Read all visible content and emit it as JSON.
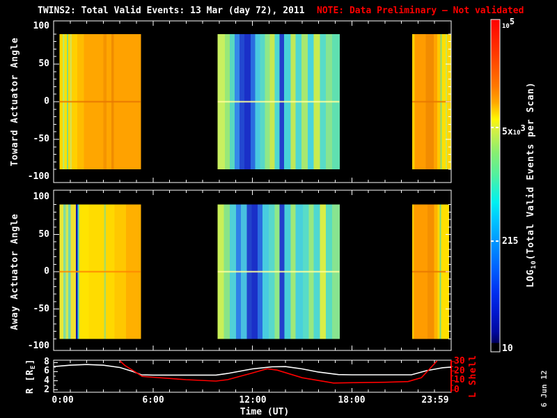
{
  "title": {
    "text": "TWINS2: Total Valid Events: 13 Mar (day  72), 2011",
    "note": "NOTE: Data Preliminary — Not validated"
  },
  "datestamp": "6 Jun 12",
  "colors": {
    "background": "#000000",
    "foreground": "#ffffff",
    "note_red": "#ff0000",
    "r_line": "#ffffff",
    "l_shell_line": "#ff0000"
  },
  "panels": {
    "toward": {
      "ylabel": "Toward Actuator Angle",
      "yticks": [
        "100",
        "50",
        "0",
        "-50",
        "-100"
      ]
    },
    "away": {
      "ylabel": "Away Actuator Angle",
      "yticks": [
        "100",
        "50",
        "0",
        "-50",
        "-100"
      ]
    },
    "bottom": {
      "rlabel_pre": "R [R",
      "rlabel_sub": "E",
      "rlabel_post": "]",
      "yticks_left": [
        "8",
        "6",
        "4",
        "2"
      ],
      "ylabel_right": "L Shell",
      "yticks_right": [
        "30",
        "20",
        "10",
        "0"
      ],
      "xlabel": "Time (UT)",
      "xticks": [
        {
          "label": "0:00",
          "h": 0
        },
        {
          "label": "6:00",
          "h": 6
        },
        {
          "label": "12:00",
          "h": 12
        },
        {
          "label": "18:00",
          "h": 18
        },
        {
          "label": "23:59",
          "h": 23.93
        }
      ]
    }
  },
  "colorbar": {
    "title_pre": "LOG",
    "title_sub": "10",
    "title_post": "(Total Valid Events per Scan)",
    "tick_top_base": "10",
    "tick_top_exp": "5",
    "tick_mid1_pre": "5x",
    "tick_mid1_base": "10",
    "tick_mid1_exp": "3",
    "tick_mid2": "215",
    "tick_bottom": "10"
  },
  "chart_data": [
    {
      "type": "heatmap",
      "name": "toward_actuator",
      "title": "Toward Actuator Angle vs Time",
      "xlim_hours": [
        0,
        24
      ],
      "ylim": [
        -100,
        100
      ],
      "data_angle_extent": [
        -90,
        90
      ],
      "blocks": [
        {
          "t0": 0.35,
          "t1": 5.25,
          "zero_line_color": "#e87800",
          "stripes": [
            [
              0,
              0.04,
              "#ffd800"
            ],
            [
              0.04,
              0.06,
              "#bfe860"
            ],
            [
              0.06,
              0.09,
              "#ffe000"
            ],
            [
              0.09,
              0.11,
              "#80dc80"
            ],
            [
              0.11,
              0.13,
              "#ffd800"
            ],
            [
              0.13,
              0.15,
              "#d8e050"
            ],
            [
              0.15,
              0.22,
              "#ffd000"
            ],
            [
              0.22,
              0.3,
              "#ffbc00"
            ],
            [
              0.3,
              0.54,
              "#ffa600"
            ],
            [
              0.54,
              0.58,
              "#f59400"
            ],
            [
              0.58,
              0.64,
              "#ffa600"
            ],
            [
              0.64,
              0.67,
              "#f08c00"
            ],
            [
              0.67,
              1,
              "#ffa200"
            ]
          ]
        },
        {
          "t0": 9.9,
          "t1": 17.25,
          "zero_line_color": "#ffff99",
          "stripes": [
            [
              0,
              0.06,
              "#c8f060"
            ],
            [
              0.06,
              0.1,
              "#98e878"
            ],
            [
              0.1,
              0.14,
              "#58d8c0"
            ],
            [
              0.14,
              0.18,
              "#3488e8"
            ],
            [
              0.18,
              0.22,
              "#2248d0"
            ],
            [
              0.22,
              0.27,
              "#1a30c8"
            ],
            [
              0.27,
              0.31,
              "#2a6ce0"
            ],
            [
              0.31,
              0.35,
              "#48c8e0"
            ],
            [
              0.35,
              0.39,
              "#58d8c8"
            ],
            [
              0.39,
              0.43,
              "#90e888"
            ],
            [
              0.43,
              0.47,
              "#c8e850"
            ],
            [
              0.47,
              0.51,
              "#50d8d0"
            ],
            [
              0.51,
              0.545,
              "#2240cc"
            ],
            [
              0.545,
              0.6,
              "#48d4d8"
            ],
            [
              0.6,
              0.64,
              "#c0e858"
            ],
            [
              0.64,
              0.69,
              "#50d8d0"
            ],
            [
              0.69,
              0.74,
              "#a8e870"
            ],
            [
              0.74,
              0.79,
              "#48d4dc"
            ],
            [
              0.79,
              0.84,
              "#c8ec50"
            ],
            [
              0.84,
              0.89,
              "#58dcc8"
            ],
            [
              0.89,
              0.94,
              "#88e490"
            ],
            [
              0.94,
              1,
              "#60e0b0"
            ]
          ]
        },
        {
          "t0": 21.65,
          "t1": 24,
          "zero_line_color": "#e87800",
          "stripes": [
            [
              0,
              0.06,
              "#ffd000"
            ],
            [
              0.06,
              0.35,
              "#ff9c00"
            ],
            [
              0.35,
              0.55,
              "#f28c00"
            ],
            [
              0.55,
              0.64,
              "#ffa400"
            ],
            [
              0.64,
              0.72,
              "#ffc800"
            ],
            [
              0.72,
              0.76,
              "#88d878"
            ],
            [
              0.76,
              0.86,
              "#ffe000"
            ],
            [
              0.86,
              0.89,
              "#c8e458"
            ],
            [
              0.89,
              1,
              "#ffd800"
            ]
          ]
        }
      ]
    },
    {
      "type": "heatmap",
      "name": "away_actuator",
      "title": "Away Actuator Angle vs Time",
      "xlim_hours": [
        0,
        24
      ],
      "ylim": [
        -100,
        100
      ],
      "data_angle_extent": [
        -90,
        90
      ],
      "blocks": [
        {
          "t0": 0.35,
          "t1": 5.25,
          "zero_line_color": "#ff8800",
          "stripes": [
            [
              0,
              0.05,
              "#e8e838"
            ],
            [
              0.05,
              0.08,
              "#80dca0"
            ],
            [
              0.08,
              0.11,
              "#d0e850"
            ],
            [
              0.11,
              0.14,
              "#70d8b0"
            ],
            [
              0.14,
              0.205,
              "#f0e030"
            ],
            [
              0.205,
              0.225,
              "#1414b0"
            ],
            [
              0.225,
              0.24,
              "#40d8c8"
            ],
            [
              0.24,
              0.36,
              "#ffe400"
            ],
            [
              0.36,
              0.55,
              "#ffdc00"
            ],
            [
              0.55,
              0.57,
              "#a8dc60"
            ],
            [
              0.57,
              0.68,
              "#ffd800"
            ],
            [
              0.68,
              0.82,
              "#ffc800"
            ],
            [
              0.82,
              1,
              "#ffb000"
            ]
          ]
        },
        {
          "t0": 9.9,
          "t1": 17.25,
          "zero_line_color": "#ffff99",
          "stripes": [
            [
              0,
              0.05,
              "#c8f058"
            ],
            [
              0.05,
              0.1,
              "#88e488"
            ],
            [
              0.1,
              0.15,
              "#50d0d8"
            ],
            [
              0.15,
              0.19,
              "#3080e8"
            ],
            [
              0.19,
              0.24,
              "#48c0e0"
            ],
            [
              0.24,
              0.28,
              "#2244cc"
            ],
            [
              0.28,
              0.33,
              "#1a30c8"
            ],
            [
              0.33,
              0.37,
              "#2a6ce0"
            ],
            [
              0.37,
              0.42,
              "#48cce0"
            ],
            [
              0.42,
              0.47,
              "#58d8cc"
            ],
            [
              0.47,
              0.51,
              "#90e888"
            ],
            [
              0.51,
              0.55,
              "#2240cc"
            ],
            [
              0.55,
              0.6,
              "#48d0d8"
            ],
            [
              0.6,
              0.64,
              "#a0e878"
            ],
            [
              0.64,
              0.7,
              "#48d0dc"
            ],
            [
              0.7,
              0.75,
              "#58dcc8"
            ],
            [
              0.75,
              0.79,
              "#98e880"
            ],
            [
              0.79,
              0.84,
              "#50d8d0"
            ],
            [
              0.84,
              0.89,
              "#d8ee48"
            ],
            [
              0.89,
              0.94,
              "#58dcc0"
            ],
            [
              0.94,
              1,
              "#88e490"
            ]
          ]
        },
        {
          "t0": 21.65,
          "t1": 23.85,
          "zero_line_color": "#e87800",
          "stripes": [
            [
              0,
              0.05,
              "#ffc800"
            ],
            [
              0.05,
              0.42,
              "#ff9c00"
            ],
            [
              0.42,
              0.6,
              "#f59000"
            ],
            [
              0.6,
              0.7,
              "#ffb400"
            ],
            [
              0.7,
              0.75,
              "#ffd800"
            ],
            [
              0.75,
              0.79,
              "#78d888"
            ],
            [
              0.79,
              1,
              "#ffe000"
            ]
          ]
        }
      ]
    },
    {
      "type": "line",
      "name": "orbit",
      "xlim_hours": [
        0,
        24
      ],
      "left_axis": {
        "label": "R [RE]",
        "range": [
          2,
          8
        ]
      },
      "right_axis": {
        "label": "L Shell",
        "range": [
          0,
          30
        ]
      },
      "series": [
        {
          "name": "R",
          "color": "#ffffff",
          "axis": "left",
          "points": [
            [
              0,
              7.1
            ],
            [
              1,
              7.4
            ],
            [
              2,
              7.55
            ],
            [
              3,
              7.4
            ],
            [
              4,
              6.9
            ],
            [
              4.8,
              6.0
            ],
            [
              5.3,
              5.3
            ],
            [
              6,
              5.25
            ],
            [
              9.8,
              5.25
            ],
            [
              10.5,
              5.6
            ],
            [
              12,
              6.6
            ],
            [
              13.2,
              7.05
            ],
            [
              14,
              7.1
            ],
            [
              15,
              6.6
            ],
            [
              16,
              5.9
            ],
            [
              17.2,
              5.35
            ],
            [
              18,
              5.3
            ],
            [
              21.6,
              5.3
            ],
            [
              22.5,
              6.2
            ],
            [
              23.5,
              6.85
            ],
            [
              24,
              7.0
            ]
          ]
        },
        {
          "name": "L Shell",
          "color": "#ff0000",
          "axis": "right",
          "points": [
            [
              4.0,
              30.7
            ],
            [
              4.3,
              26
            ],
            [
              5.35,
              14.5
            ],
            [
              6,
              13.5
            ],
            [
              8,
              11
            ],
            [
              9.8,
              9.5
            ],
            [
              10.5,
              11
            ],
            [
              12,
              18
            ],
            [
              12.9,
              22.5
            ],
            [
              13.5,
              21
            ],
            [
              15,
              13
            ],
            [
              16.9,
              7.5
            ],
            [
              18,
              7.8
            ],
            [
              20,
              8.3
            ],
            [
              21.4,
              9.0
            ],
            [
              22.2,
              13
            ],
            [
              23.15,
              30.7
            ]
          ]
        }
      ]
    },
    {
      "type": "colorbar",
      "scale": "log10",
      "range": [
        10,
        100000
      ],
      "tick_values": [
        "1e5",
        "5e3",
        "215",
        "10"
      ],
      "tick_fractions_from_top": [
        0,
        0.325,
        0.667,
        1
      ],
      "gradient": [
        [
          0,
          "#ff0000"
        ],
        [
          0.1,
          "#ff3800"
        ],
        [
          0.2,
          "#ff7800"
        ],
        [
          0.25,
          "#ffa800"
        ],
        [
          0.28,
          "#ffd800"
        ],
        [
          0.3,
          "#fff800"
        ],
        [
          0.33,
          "#d8f040"
        ],
        [
          0.4,
          "#88ee70"
        ],
        [
          0.47,
          "#50f0a0"
        ],
        [
          0.5,
          "#30f0c0"
        ],
        [
          0.55,
          "#00f0f0"
        ],
        [
          0.6,
          "#00c8ff"
        ],
        [
          0.667,
          "#0098ff"
        ],
        [
          0.75,
          "#0060ff"
        ],
        [
          0.82,
          "#0030f0"
        ],
        [
          0.88,
          "#0018d0"
        ],
        [
          0.94,
          "#0008a0"
        ],
        [
          0.972,
          "#000060"
        ],
        [
          0.975,
          "#000000"
        ],
        [
          1,
          "#000000"
        ]
      ]
    }
  ]
}
